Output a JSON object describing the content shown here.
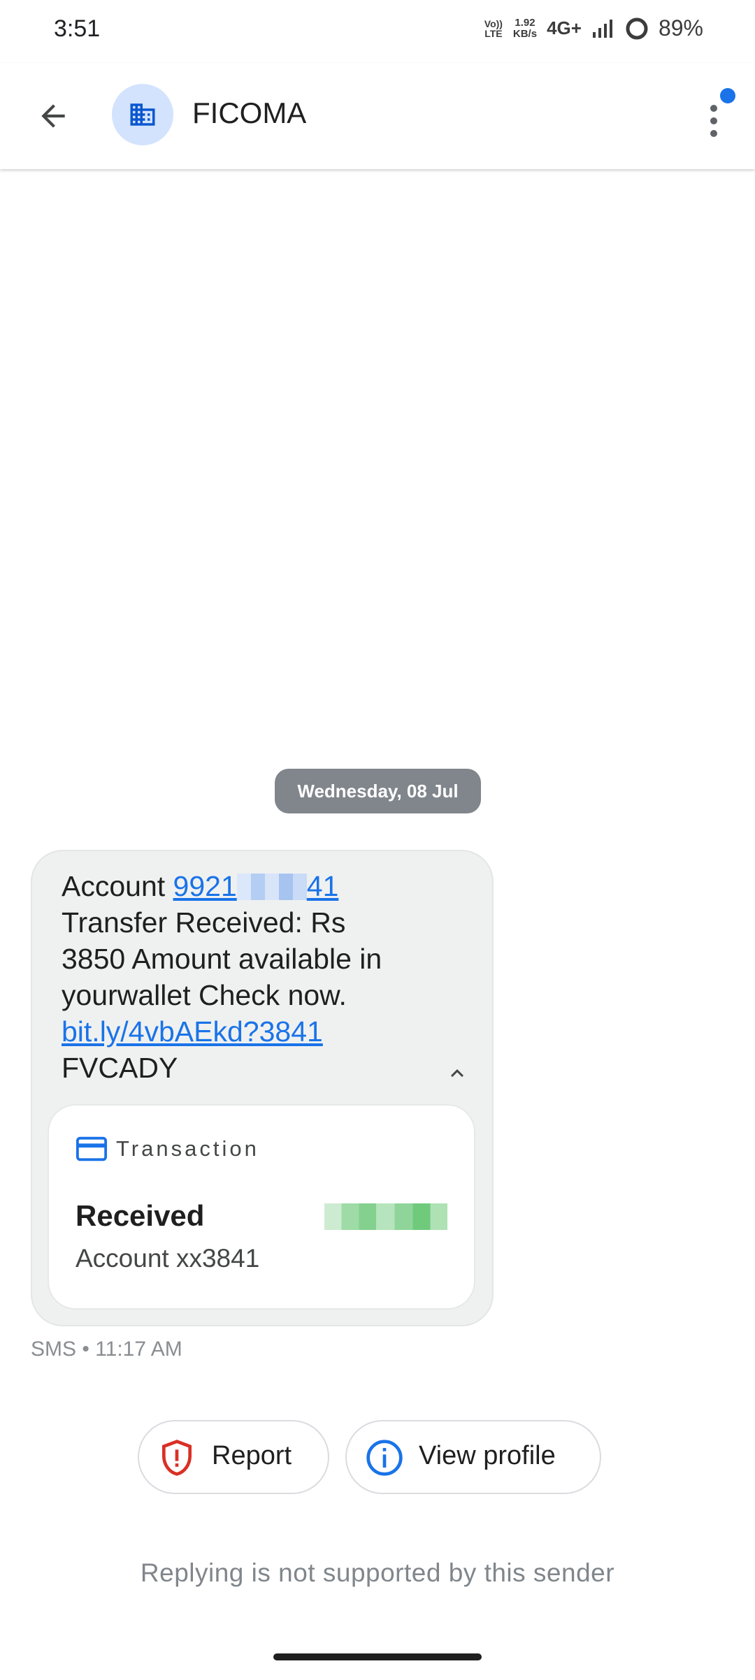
{
  "status_bar": {
    "time": "3:51",
    "volte_top": "Vo))",
    "volte_bottom": "LTE",
    "net_speed_value": "1.92",
    "net_speed_unit": "KB/s",
    "network_type": "4G+",
    "battery_percent": "89%"
  },
  "header": {
    "title": "FICOMA",
    "avatar_icon": "building-icon",
    "has_notification_dot": true
  },
  "conversation": {
    "date_chip": "Wednesday, 08 Jul",
    "message": {
      "account_prefix": "Account ",
      "account_number_start": "9921",
      "account_number_end": "41",
      "line2": "Transfer Received: Rs",
      "line3": "3850 Amount available in",
      "line4": "yourwallet Check now.",
      "link": "bit.ly/4vbAEkd?3841",
      "line6": "FVCADY"
    },
    "transaction_card": {
      "header_label": "Transaction",
      "status": "Received",
      "account": "Account xx3841"
    },
    "meta": "SMS • 11:17 AM"
  },
  "actions": {
    "report_label": "Report",
    "view_profile_label": "View profile"
  },
  "footer": {
    "no_reply_text": "Replying is not supported by this sender"
  },
  "colors": {
    "accent": "#1a73e8",
    "report_red": "#d93025",
    "bubble_bg": "#eff1f1",
    "avatar_bg": "#d3e3fd",
    "date_chip_bg": "#80868b"
  }
}
